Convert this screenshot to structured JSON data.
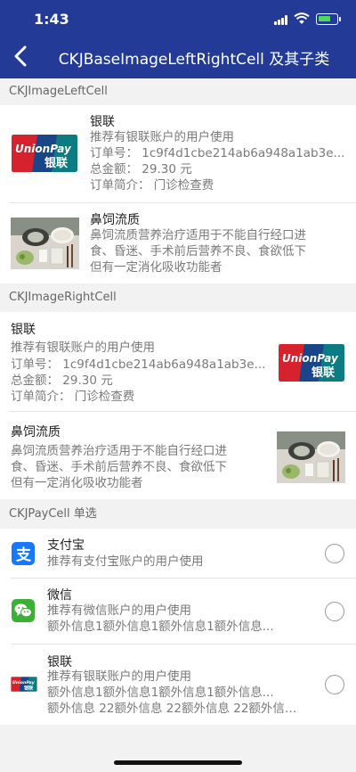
{
  "status_bar": {
    "time": "1:43"
  },
  "nav": {
    "title": "CKJBaseImageLeftRightCell 及其子类"
  },
  "sections": {
    "left": "CKJImageLeftCell",
    "right": "CKJImageRightCell",
    "pay": "CKJPayCell 单选"
  },
  "card_unionpay": {
    "title": "银联",
    "desc": "推荐有银联账户的用户使用",
    "order_no": "订单号：  1c9f4d1cbe214ab6a948a1ab3e...",
    "amount": "总金额：  29.30 元",
    "brief": "订单简介：  门诊检查费"
  },
  "card_food": {
    "title": "鼻饲流质",
    "line1": "鼻饲流质营养治疗适用于不能自行经口进",
    "line2": "食、昏迷、手术前后营养不良、食欲低下",
    "line3": "但有一定消化吸收功能者"
  },
  "pay_items": {
    "alipay": {
      "title": "支付宝",
      "desc": "推荐有支付宝账户的用户使用",
      "icon": "alipay-icon",
      "color": "#1677ff"
    },
    "wechat": {
      "title": "微信",
      "desc": "推荐有微信账户的用户使用",
      "extra1": "额外信息1额外信息1额外信息1额外信息...",
      "icon": "wechat-icon",
      "color": "#3cb034"
    },
    "union": {
      "title": "银联",
      "desc": "推荐有银联账户的用户使用",
      "extra1": "额外信息1额外信息1额外信息1额外信息...",
      "extra2": "额外信息 22额外信息 22额外信息 22额外信息 ...",
      "icon": "unionpay-icon"
    }
  },
  "logo": {
    "text": "UnionPay",
    "cn": "银联"
  },
  "colors": {
    "nav": "#233b96",
    "union_red": "#d6222c",
    "union_blue": "#1a4689",
    "union_teal": "#0a7c82"
  }
}
